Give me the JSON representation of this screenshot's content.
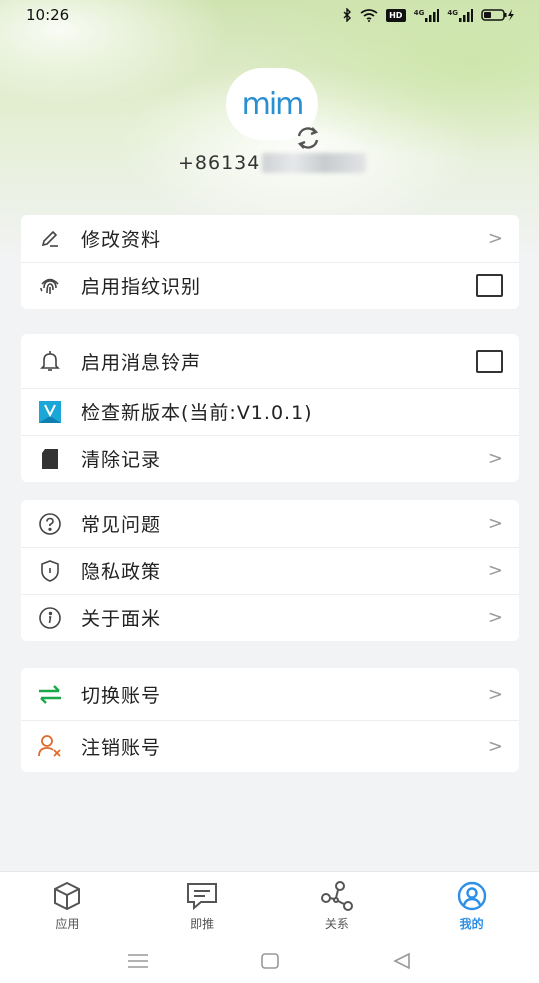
{
  "status_bar": {
    "time": "10:26",
    "signal1_tag": "4G",
    "signal2_tag": "4G",
    "hd_badge": "HD"
  },
  "profile": {
    "avatar_logo": "mim",
    "phone_prefix": "+86134"
  },
  "menu_groups": [
    {
      "items": [
        {
          "label": "修改资料",
          "icon": "edit-pencil-icon",
          "trail": ">"
        },
        {
          "label": "启用指纹识别",
          "icon": "fingerprint-icon",
          "trail": "checkbox"
        }
      ]
    },
    {
      "items": [
        {
          "label": "启用消息铃声",
          "icon": "bell-icon",
          "trail": "checkbox"
        },
        {
          "label": "检查新版本(当前:V1.0.1)",
          "icon": "version-badge-icon",
          "trail": ""
        },
        {
          "label": "清除记录",
          "icon": "sd-card-icon",
          "trail": ">"
        }
      ]
    },
    {
      "items": [
        {
          "label": "常见问题",
          "icon": "question-circle-icon",
          "trail": ">"
        },
        {
          "label": "隐私政策",
          "icon": "shield-icon",
          "trail": ">"
        },
        {
          "label": "关于面米",
          "icon": "info-circle-icon",
          "trail": ">"
        }
      ]
    },
    {
      "items": [
        {
          "label": "切换账号",
          "icon": "switch-arrows-icon",
          "trail": ">"
        },
        {
          "label": "注销账号",
          "icon": "user-remove-icon",
          "trail": ">"
        }
      ]
    }
  ],
  "chevron": ">",
  "bottom_nav": [
    {
      "label": "应用",
      "icon": "cube-icon",
      "active": false
    },
    {
      "label": "即推",
      "icon": "message-icon",
      "active": false
    },
    {
      "label": "关系",
      "icon": "network-icon",
      "active": false
    },
    {
      "label": "我的",
      "icon": "user-circle-icon",
      "active": true
    }
  ],
  "colors": {
    "accent": "#2e8fe6",
    "switch_green": "#19a84a",
    "logout_orange": "#e06a2c",
    "version_blue": "#1aa7d8"
  }
}
